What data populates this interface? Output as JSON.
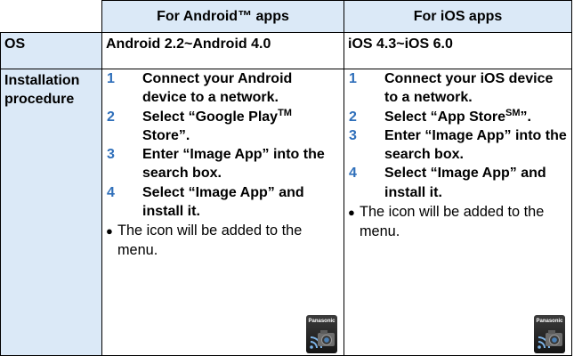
{
  "columns": {
    "android": "For Android™ apps",
    "ios": "For iOS apps"
  },
  "rows": {
    "os": {
      "label": "OS",
      "android": "Android 2.2~Android 4.0",
      "ios": "iOS 4.3~iOS 6.0"
    },
    "installation": {
      "label_line1": "Installation",
      "label_line2": "procedure"
    }
  },
  "android_steps": [
    {
      "num": "1",
      "text": "Connect your Android device to a network."
    },
    {
      "num": "2",
      "text_before": "Select “Google Play",
      "mark": "TM",
      "text_after": " Store”."
    },
    {
      "num": "3",
      "text": "Enter “Image App” into the search box."
    },
    {
      "num": "4",
      "text": "Select “Image App” and install it."
    }
  ],
  "ios_steps": [
    {
      "num": "1",
      "text": "Connect your iOS device to a network."
    },
    {
      "num": "2",
      "text_before": "Select “App Store",
      "mark": "SM",
      "text_after": "”."
    },
    {
      "num": "3",
      "text": "Enter “Image App” into the search box."
    },
    {
      "num": "4",
      "text": "Select “Image App” and install it."
    }
  ],
  "note": {
    "bullet": "●",
    "text": "The icon will be added to the menu."
  },
  "app_icon": {
    "name": "image-app-icon",
    "brand": "Panasonic"
  }
}
